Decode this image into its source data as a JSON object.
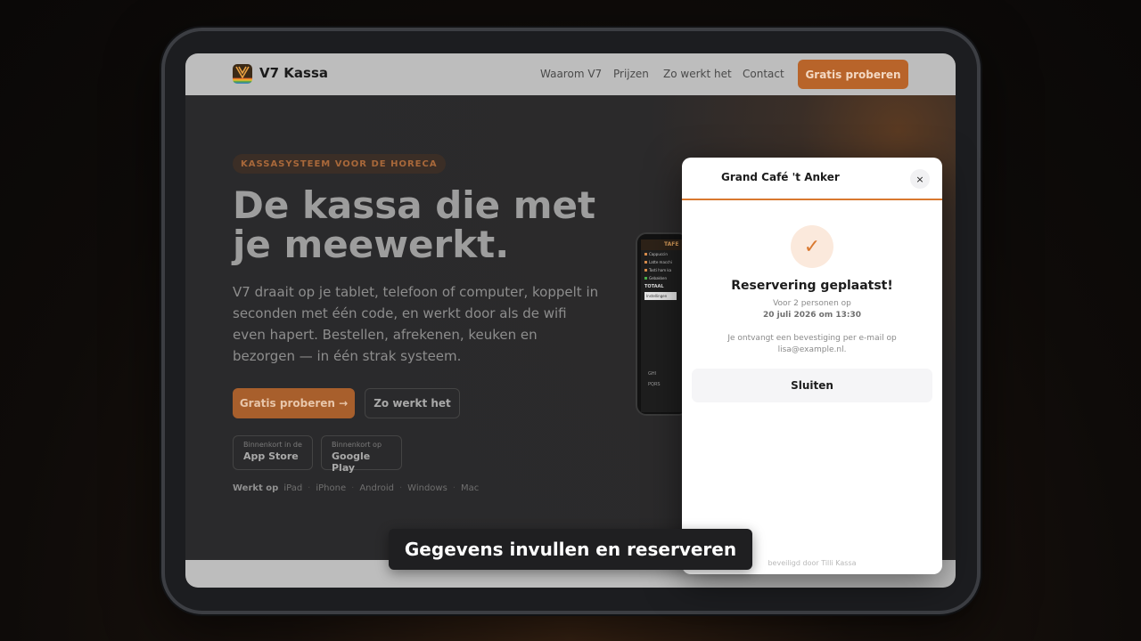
{
  "nav": {
    "brand": "V7 Kassa",
    "links": [
      "Waarom V7",
      "Prijzen",
      "Zo werkt het",
      "Contact"
    ],
    "cta": "Gratis proberen"
  },
  "hero": {
    "eyebrow": "KASSASYSTEEM VOOR DE HORECA",
    "title_line1": "De kassa die met",
    "title_line2": "je meewerkt.",
    "lead": "V7 draait op je tablet, telefoon of computer, koppelt in seconden met één code, en werkt door als de wifi even hapert. Bestellen, afrekenen, keuken en bezorgen — in één strak systeem.",
    "primary_button": "Gratis proberen →",
    "secondary_button": "Zo werkt het",
    "stores": [
      {
        "small": "Binnenkort in de",
        "big": "App Store"
      },
      {
        "small": "Binnenkort op",
        "big": "Google Play"
      }
    ],
    "works_label": "Werkt op",
    "platforms": [
      "iPad",
      "iPhone",
      "Android",
      "Windows",
      "Mac"
    ]
  },
  "phone": {
    "header": "TAFE",
    "rows": [
      "Cappuccin",
      "Latte macchi",
      "Tosti ham ka",
      "Gebakken"
    ],
    "total": "TOTAAL",
    "button": "Instellingen",
    "keys": [
      "GHI",
      "PQRS"
    ]
  },
  "modal": {
    "title": "Grand Café 't Anker",
    "close_symbol": "×",
    "check_symbol": "✓",
    "heading": "Reservering geplaatst!",
    "sub": "Voor 2 personen op",
    "date": "20 juli 2026 om 13:30",
    "confirm": "Je ontvangt een bevestiging per e-mail op lisa@example.nl.",
    "close_button": "Sluiten",
    "footer": "beveiligd door Tilli Kassa"
  },
  "caption": "Gegevens invullen en reserveren",
  "colors": {
    "accent": "#d9782f",
    "cta_dim": "#b8642a",
    "modal_bg": "#ffffff"
  }
}
